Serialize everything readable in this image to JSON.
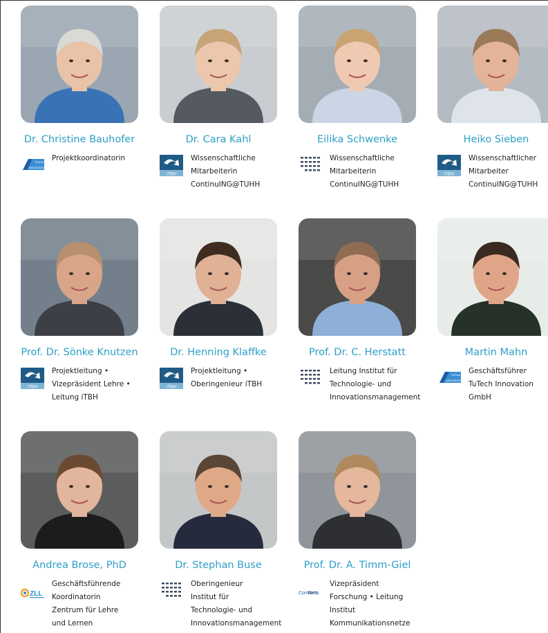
{
  "people": [
    {
      "name": "Dr. Christine Bauhofer",
      "org_icon": "tutech-logo",
      "lines": [
        "Projektkoordinatorin"
      ],
      "bg": "#9aa7b3",
      "skin": "#e9c3a8",
      "hair": "#d9d9d6",
      "shirt": "#3a73b5"
    },
    {
      "name": "Dr. Cara Kahl",
      "org_icon": "itbh-logo",
      "lines": [
        "Wissenschaftliche",
        "Mitarbeiterin",
        "ContinuING@TUHH"
      ],
      "bg": "#c9cdd1",
      "skin": "#ecc7ae",
      "hair": "#c7a477",
      "shirt": "#555a60"
    },
    {
      "name": "Eilika Schwenke",
      "org_icon": "tim-logo",
      "lines": [
        "Wissenschaftliche",
        "Mitarbeiterin",
        "ContinuING@TUHH"
      ],
      "bg": "#a5adb4",
      "skin": "#f0c9b3",
      "hair": "#caa372",
      "shirt": "#cad6e6"
    },
    {
      "name": "Heiko Sieben",
      "org_icon": "itbh-logo",
      "lines": [
        "Wissenschaftlicher",
        "Mitarbeiter",
        "ContinuING@TUHH"
      ],
      "bg": "#b4bbc2",
      "skin": "#e3b498",
      "hair": "#9b7a5a",
      "shirt": "#dfe4ea"
    },
    {
      "name": "Prof. Dr. Sönke Knutzen",
      "org_icon": "itbh-logo",
      "lines": [
        "Projektleitung •",
        "Vizepräsident Lehre •",
        "Leitung iTBH"
      ],
      "bg": "#73808b",
      "skin": "#d9a588",
      "hair": "#b8906f",
      "shirt": "#3c3f45"
    },
    {
      "name": "Dr. Henning Klaffke",
      "org_icon": "itbh-logo",
      "lines": [
        "Projektleitung •",
        "Oberingenieur iTBH"
      ],
      "bg": "#e4e4e2",
      "skin": "#e0b195",
      "hair": "#3e2c20",
      "shirt": "#2b2f38"
    },
    {
      "name": "Prof. Dr. C. Herstatt",
      "org_icon": "tim-logo",
      "lines": [
        "Leitung Institut für",
        "Technologie- und",
        "Innovationsmanagement"
      ],
      "bg": "#4a4a48",
      "skin": "#d7a085",
      "hair": "#8f6c52",
      "shirt": "#8eb0d8"
    },
    {
      "name": "Martin Mahn",
      "org_icon": "tutech-logo",
      "lines": [
        "Geschäftsführer",
        "TuTech Innovation",
        "GmbH"
      ],
      "bg": "#e8ece9",
      "skin": "#e0a588",
      "hair": "#3a2a22",
      "shirt": "#263129"
    },
    {
      "name": "Andrea Brose, PhD",
      "org_icon": "zll-logo",
      "lines": [
        "Geschäftsführende",
        "Koordinatorin",
        "Zentrum für Lehre",
        "und Lernen"
      ],
      "bg": "#5b5d5c",
      "skin": "#e2b69c",
      "hair": "#6b4a33",
      "shirt": "#1c1c1e"
    },
    {
      "name": "Dr. Stephan Buse",
      "org_icon": "tim-logo",
      "lines": [
        "Oberingenieur",
        "Institut für",
        "Technologie- und",
        "Innovationsmanagement"
      ],
      "bg": "#c4c7c8",
      "skin": "#dfa988",
      "hair": "#5a4637",
      "shirt": "#252b3d"
    },
    {
      "name": "Prof. Dr. A. Timm-Giel",
      "org_icon": "comnets-logo",
      "lines": [
        "Vizepräsident",
        "Forschung • Leitung",
        "Institut",
        "Kommunikationsnetze"
      ],
      "bg": "#8f959a",
      "skin": "#e5b79c",
      "hair": "#b08a5e",
      "shirt": "#2d2f33"
    }
  ]
}
